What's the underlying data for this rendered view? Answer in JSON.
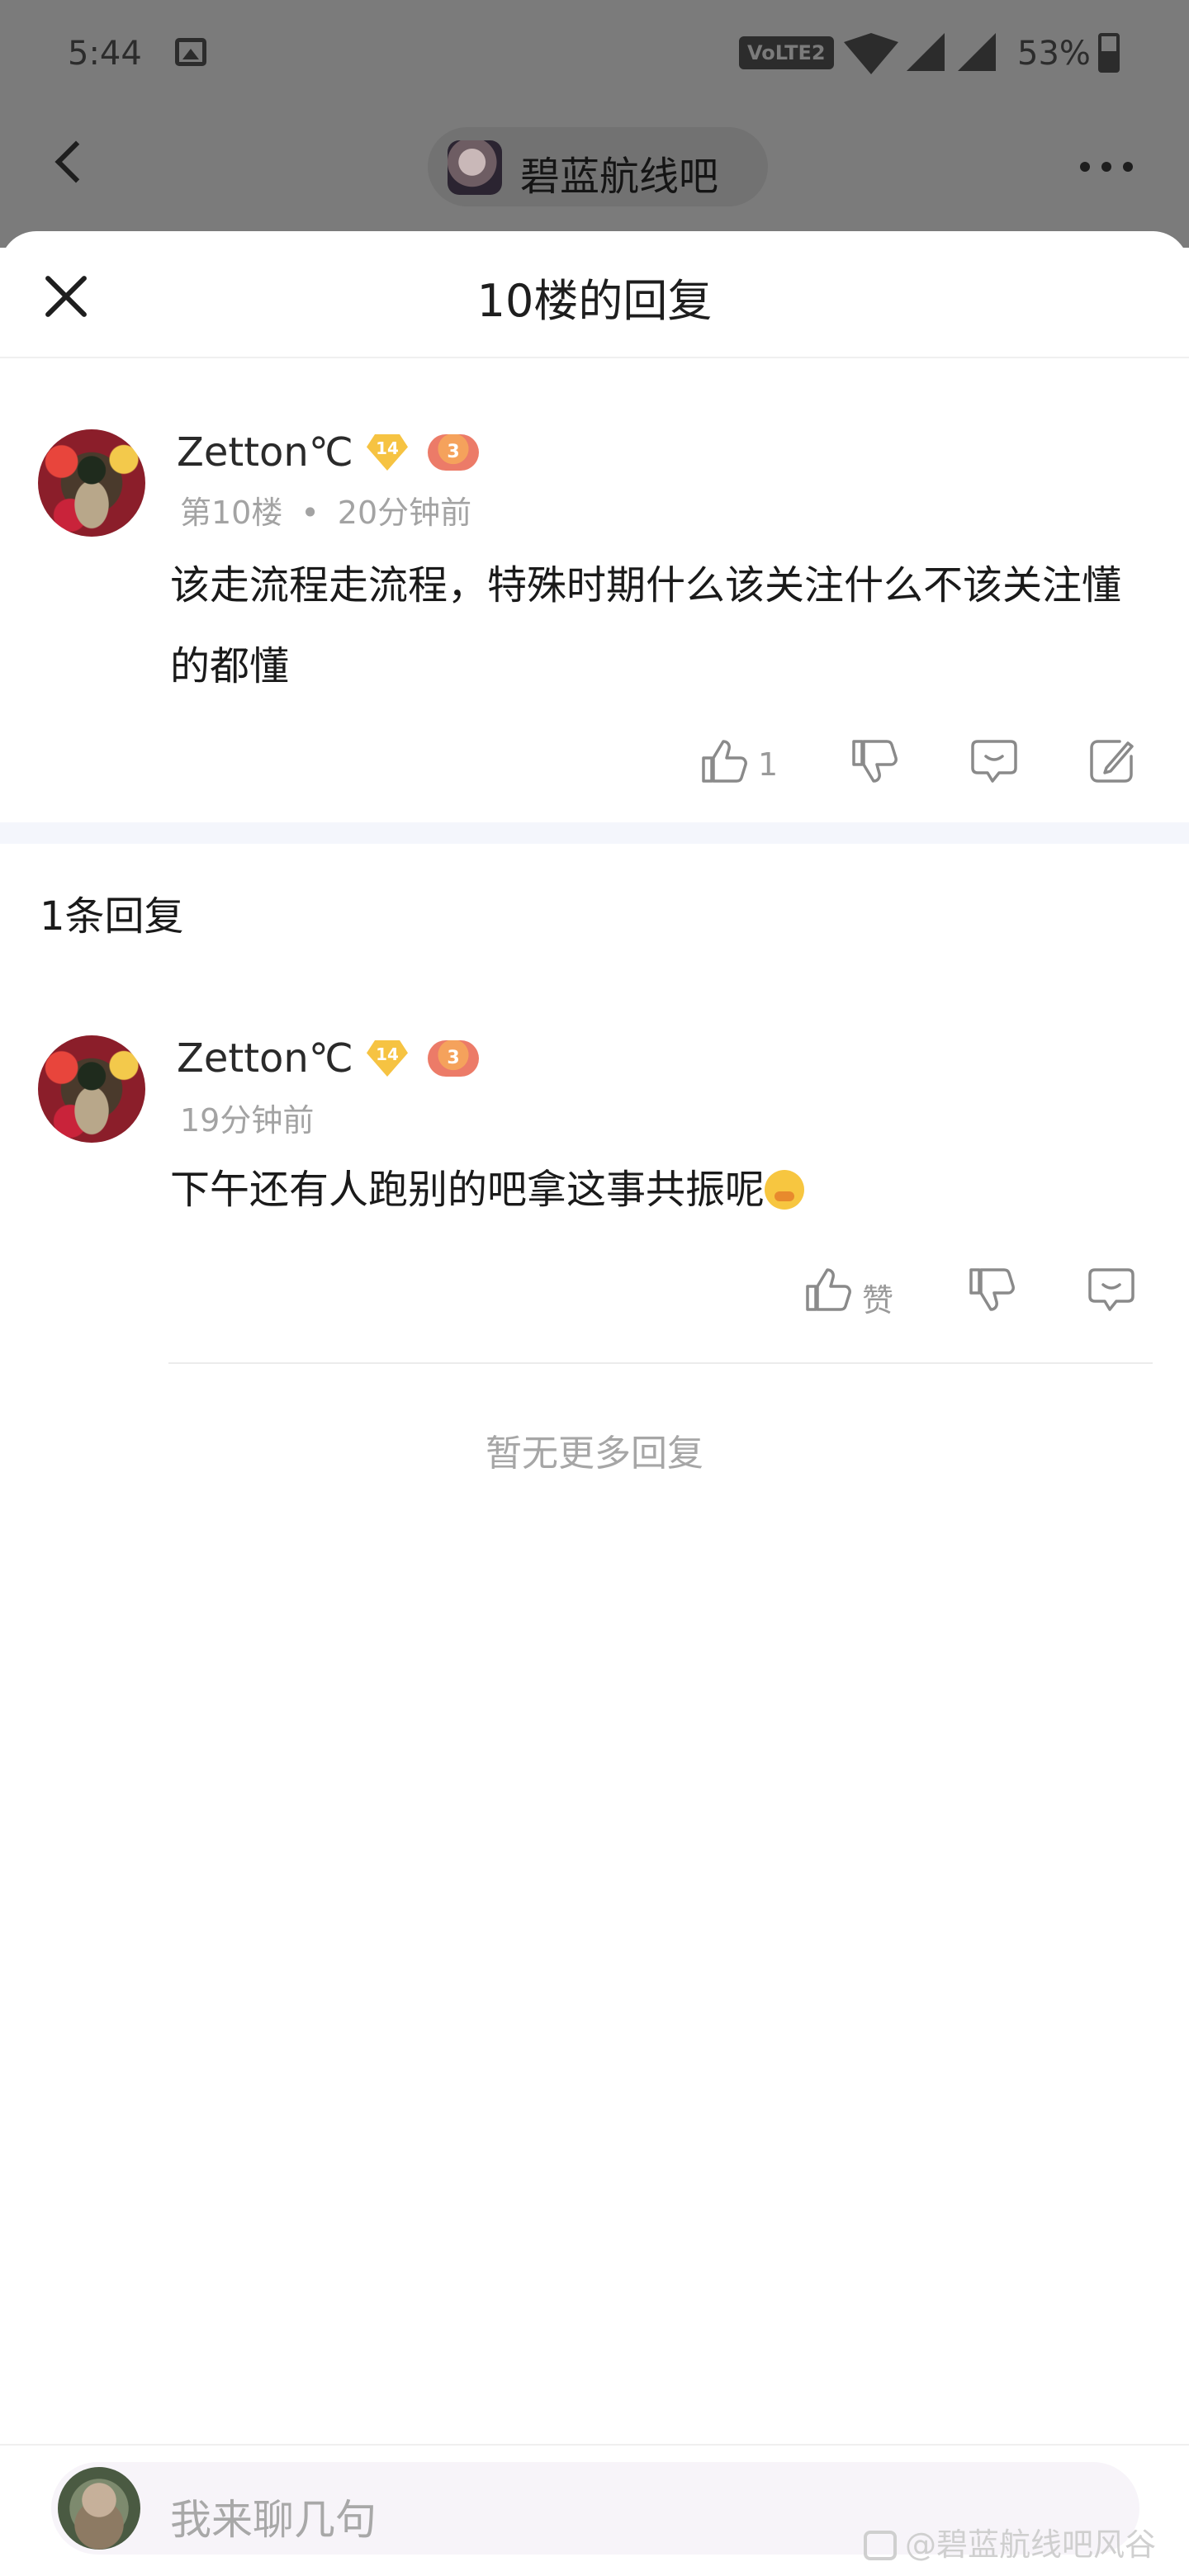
{
  "status_bar": {
    "time": "5:44",
    "volte": "VoLTE2",
    "battery": "53%"
  },
  "background_header": {
    "forum_name": "碧蓝航线吧"
  },
  "sheet": {
    "title": "10楼的回复"
  },
  "main_post": {
    "username": "Zetton℃",
    "level": "14",
    "game_level": "3",
    "floor": "第10楼",
    "separator": "•",
    "time": "20分钟前",
    "content": "该走流程走流程，特殊时期什么该关注什么不该关注懂的都懂",
    "like_count": "1"
  },
  "replies_header": {
    "count_label": "1条回复"
  },
  "reply": {
    "username": "Zetton℃",
    "level": "14",
    "game_level": "3",
    "time": "19分钟前",
    "content": "下午还有人跑别的吧拿这事共振呢",
    "like_label": "赞"
  },
  "no_more_label": "暂无更多回复",
  "input": {
    "placeholder": "我来聊几句"
  },
  "watermark": "@碧蓝航线吧风谷",
  "icons": {
    "back": "chevron-left-icon",
    "more": "more-dots-icon",
    "close": "close-icon",
    "like": "thumbs-up-icon",
    "dislike": "thumbs-down-icon",
    "comment": "comment-icon",
    "edit": "edit-icon"
  },
  "colors": {
    "background_overlay": "#7b7b7b",
    "sheet": "#ffffff",
    "divider_band": "#f4f6fc",
    "muted_text": "#a3a3a3",
    "level_badge": "#f6c342"
  }
}
